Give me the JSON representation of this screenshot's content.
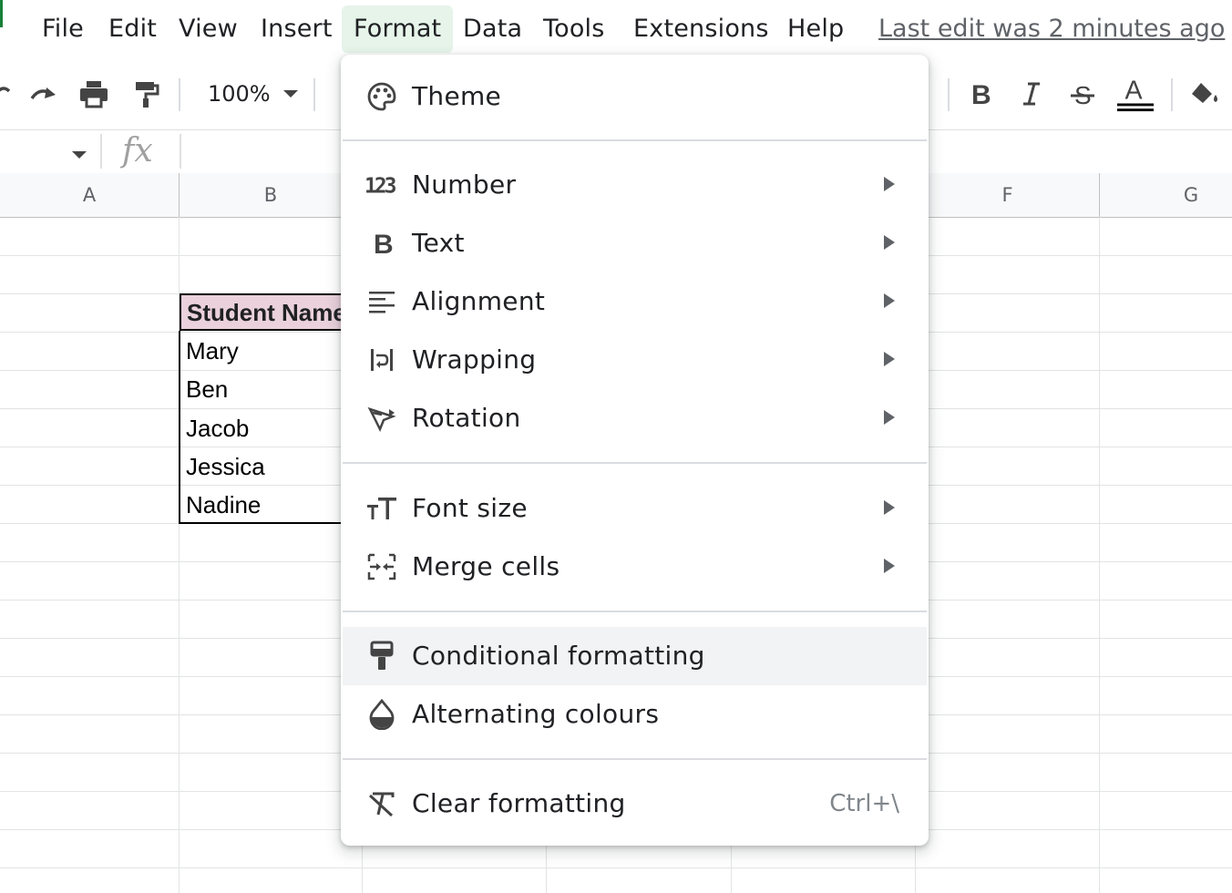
{
  "menubar": {
    "items": [
      {
        "label": "File"
      },
      {
        "label": "Edit"
      },
      {
        "label": "View"
      },
      {
        "label": "Insert"
      },
      {
        "label": "Format"
      },
      {
        "label": "Data"
      },
      {
        "label": "Tools"
      },
      {
        "label": "Extensions"
      },
      {
        "label": "Help"
      }
    ],
    "active_item": "Format",
    "last_edit": "Last edit was 2 minutes ago"
  },
  "toolbar": {
    "zoom": "100%",
    "icons": [
      "undo-icon",
      "redo-icon",
      "print-icon",
      "paint-format-icon",
      "bold-icon",
      "italic-icon",
      "strikethrough-icon",
      "text-color-icon",
      "fill-color-icon"
    ]
  },
  "formula_bar": {
    "fx_label": "fx"
  },
  "grid": {
    "columns": [
      "A",
      "B",
      "F",
      "G"
    ],
    "header_cell": "Student Name",
    "names": [
      "Mary",
      "Ben",
      "Jacob",
      "Jessica",
      "Nadine"
    ]
  },
  "format_menu": {
    "theme": {
      "label": "Theme",
      "icon": "palette-icon"
    },
    "number": {
      "label": "Number",
      "icon": "number-format-icon"
    },
    "text": {
      "label": "Text",
      "icon": "bold-b-icon"
    },
    "alignment": {
      "label": "Alignment",
      "icon": "align-left-icon"
    },
    "wrapping": {
      "label": "Wrapping",
      "icon": "wrap-icon"
    },
    "rotation": {
      "label": "Rotation",
      "icon": "text-rotation-icon"
    },
    "font_size": {
      "label": "Font size",
      "icon": "font-size-icon"
    },
    "merge_cells": {
      "label": "Merge cells",
      "icon": "merge-cells-icon"
    },
    "conditional_formatting": {
      "label": "Conditional formatting",
      "icon": "paint-roller-icon"
    },
    "alternating_colours": {
      "label": "Alternating colours",
      "icon": "drop-icon"
    },
    "clear_formatting": {
      "label": "Clear formatting",
      "shortcut": "Ctrl+\\",
      "icon": "clear-format-icon"
    }
  },
  "colors": {
    "accent_green": "#188038",
    "menu_active_bg": "#e6f4ea",
    "header_fill": "#ead1dc",
    "hover_row": "#f1f3f4"
  }
}
